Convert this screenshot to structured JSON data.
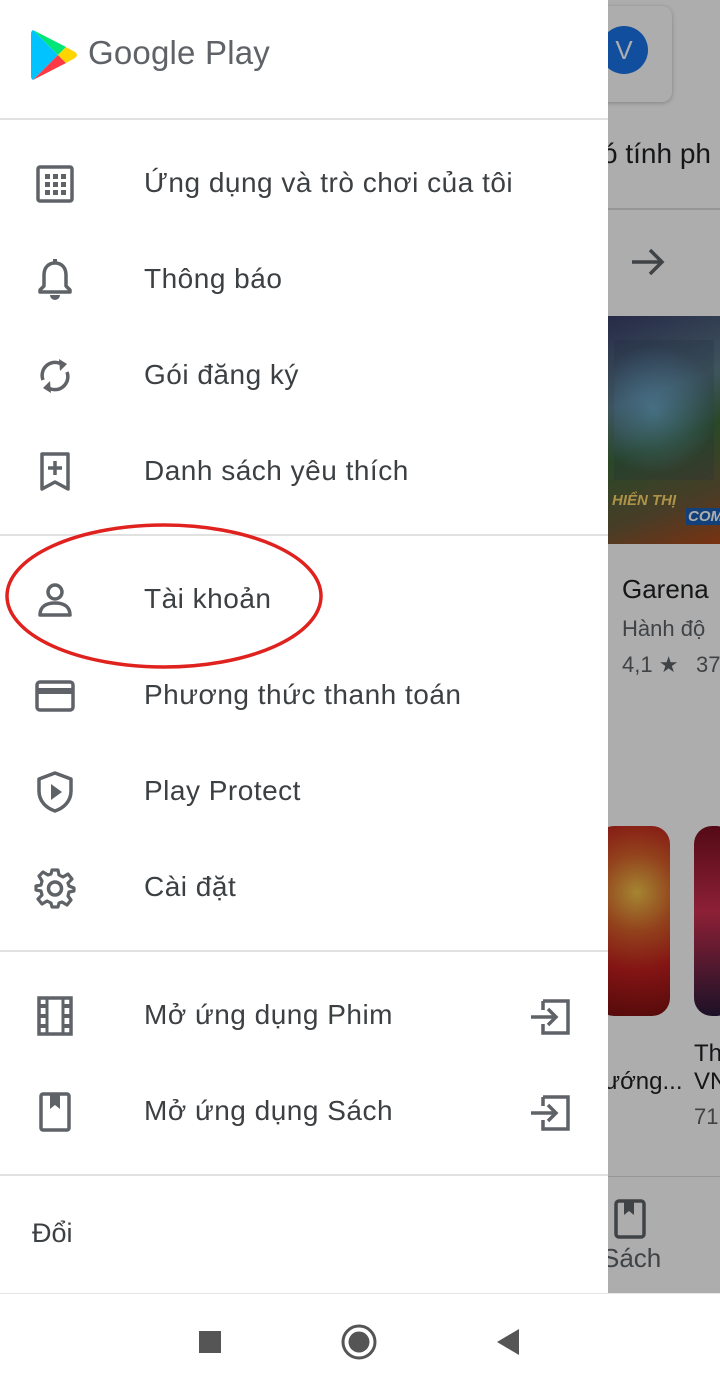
{
  "drawer": {
    "brand": "Google Play",
    "sections": [
      [
        {
          "label": "Ứng dụng và trò chơi của tôi",
          "icon": "grid-icon"
        },
        {
          "label": "Thông báo",
          "icon": "bell-icon"
        },
        {
          "label": "Gói đăng ký",
          "icon": "refresh-icon"
        },
        {
          "label": "Danh sách yêu thích",
          "icon": "bookmark-add-icon"
        }
      ],
      [
        {
          "label": "Tài khoản",
          "icon": "person-icon"
        },
        {
          "label": "Phương thức thanh toán",
          "icon": "credit-card-icon"
        },
        {
          "label": "Play Protect",
          "icon": "shield-play-icon"
        },
        {
          "label": "Cài đặt",
          "icon": "gear-icon"
        }
      ],
      [
        {
          "label": "Mở ứng dụng Phim",
          "icon": "film-icon",
          "trailing_icon": "open-app-icon"
        },
        {
          "label": "Mở ứng dụng Sách",
          "icon": "book-icon",
          "trailing_icon": "open-app-icon"
        }
      ]
    ],
    "footer_label": "Đổi"
  },
  "background": {
    "avatar_letter": "V",
    "section_heading_partial": "ó tính ph",
    "app_title_partial": "Garena",
    "app_category_partial": "Hành độ",
    "app_rating_partial": "4,1 ★",
    "app_count_partial": "37",
    "banner_text_1": "HIỂN THỊ",
    "banner_text_2": "COM",
    "card_text_1": "ướng...",
    "card_text_2": "Th\nVN",
    "card_count": "71",
    "bottom_tab_label": "Sách"
  },
  "colors": {
    "highlight_oval": "#e0221f",
    "text_primary": "#3c4043",
    "icon_color": "#5f6368",
    "avatar_blue": "#1a73e8"
  }
}
